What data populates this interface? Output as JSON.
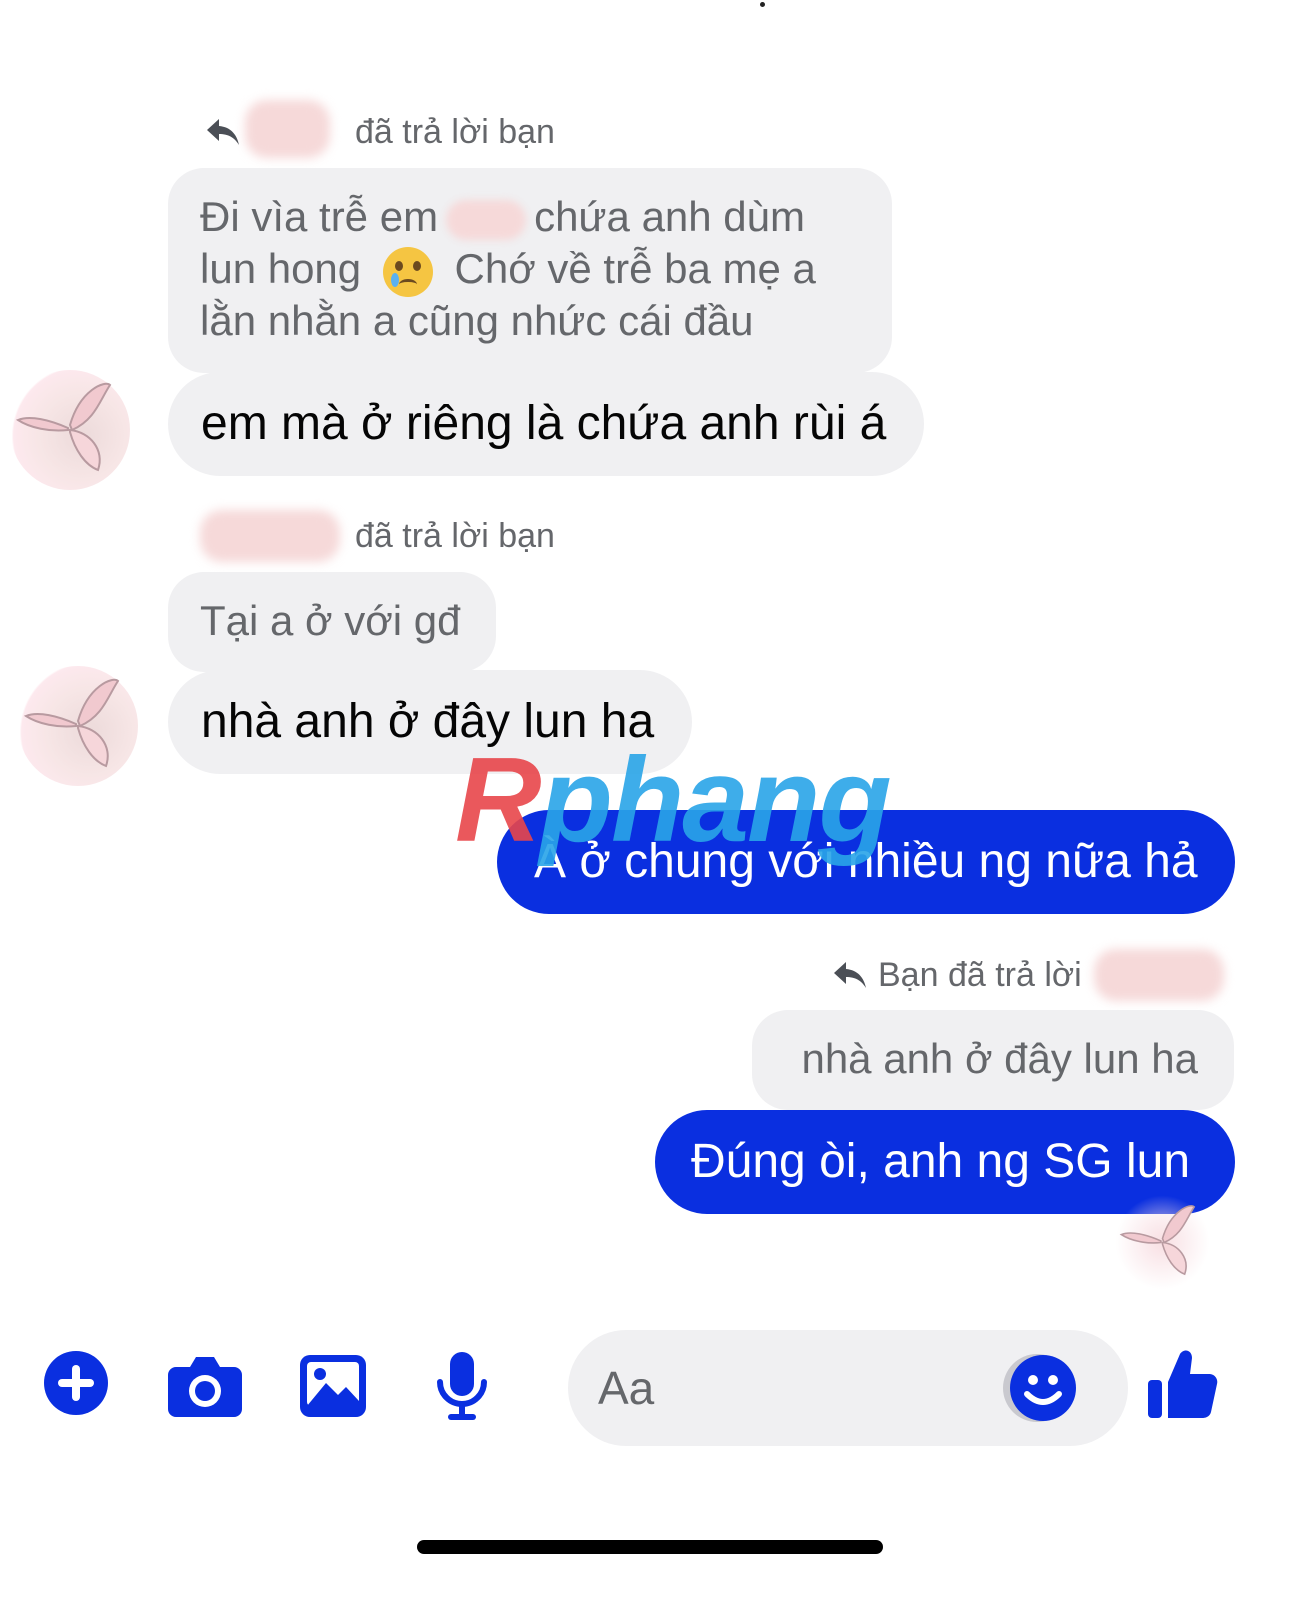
{
  "thread": {
    "group1": {
      "reply_header": "đã trả lời bạn",
      "quote_lines": [
        "Đi vìa trễ em",
        "chứa anh dùm",
        "lun hong",
        "Chớ về trễ ba mẹ a",
        "lằn nhằn a cũng nhức cái đầu"
      ],
      "message": "em mà ở riêng là chứa anh rùi á"
    },
    "group2": {
      "reply_header": "đã trả lời bạn",
      "quote": "Tại a ở với gđ",
      "message": "nhà anh ở đây lun ha"
    },
    "outgoing1": {
      "message": "À ở chung với nhiều ng nữa hả"
    },
    "group3": {
      "reply_header": "Bạn đã trả lời",
      "quote": "nhà anh ở đây lun ha",
      "message": "Đúng òi, anh ng SG lun"
    },
    "watermark": {
      "first": "R",
      "rest": "phang"
    }
  },
  "composer": {
    "placeholder": "Aa"
  },
  "colors": {
    "accent": "#0a2fe0",
    "bubble_in": "#f0f0f2",
    "meta_text": "#65676b"
  },
  "icons": [
    "reply-arrow-icon",
    "plus-circle-icon",
    "camera-icon",
    "image-icon",
    "microphone-icon",
    "emoji-icon",
    "thumbs-up-icon"
  ]
}
